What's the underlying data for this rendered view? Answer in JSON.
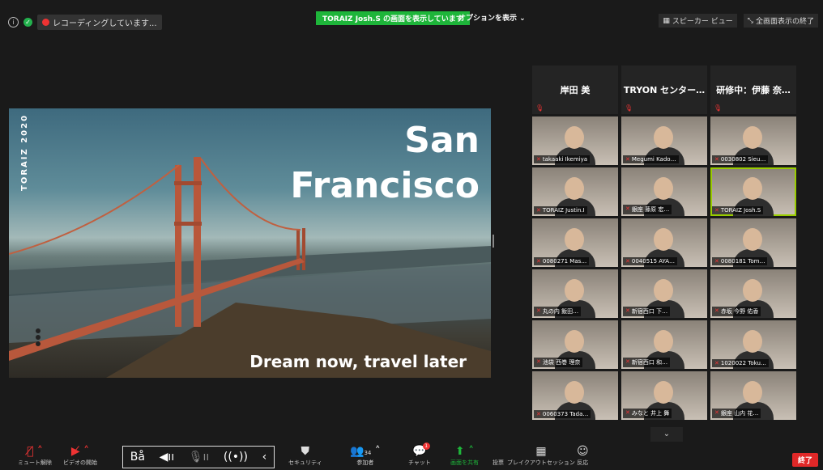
{
  "topbar": {
    "recording_label": "レコーディングしています...",
    "share_banner": "TORAIZ Josh.S の画面を表示しています",
    "options_label": "オプションを表示 ⌄",
    "speaker_view": "スピーカー ビュー",
    "fullscreen": "全画面表示の終了"
  },
  "slide": {
    "side_text": "TORAIZ 2020",
    "title_line1": "San",
    "title_line2": "Francisco",
    "tagline": "Dream now, travel later"
  },
  "gallery": {
    "name_tiles": [
      "岸田 美",
      "TRYON センター…",
      "研修中：伊藤 奈…"
    ],
    "video_tiles": [
      {
        "name": "takaaki Ikemiya"
      },
      {
        "name": "Megumi Kado…"
      },
      {
        "name": "0030802 Sieu…"
      },
      {
        "name": "TORAIZ Justin.I"
      },
      {
        "name": "銀座 藤原 宏…"
      },
      {
        "name": "TORAIZ Josh.S",
        "active": true
      },
      {
        "name": "0080271 Mas…"
      },
      {
        "name": "0040515 AYA…"
      },
      {
        "name": "0080181 Tom…"
      },
      {
        "name": "丸の内 飯田…"
      },
      {
        "name": "新宿西口 下…"
      },
      {
        "name": "赤坂 今野 佑香"
      },
      {
        "name": "池袋 西巻 理奈"
      },
      {
        "name": "新宿西口 和…"
      },
      {
        "name": "1020022 Toku…"
      },
      {
        "name": "0060373 Tada…"
      },
      {
        "name": "みなと 井上 舞"
      },
      {
        "name": "銀座 山内 花…"
      }
    ]
  },
  "toolbar": {
    "mute_label": "ミュート解除",
    "video_label": "ビデオの開始",
    "security_label": "セキュリティ",
    "participants_label": "参加者",
    "participants_count": "34",
    "chat_label": "チャット",
    "chat_badge": "1",
    "share_label": "画面を共有",
    "poll_label": "投票",
    "breakout_label": "ブレイクアウトセッション",
    "reaction_label": "反応",
    "end_label": "終了"
  }
}
